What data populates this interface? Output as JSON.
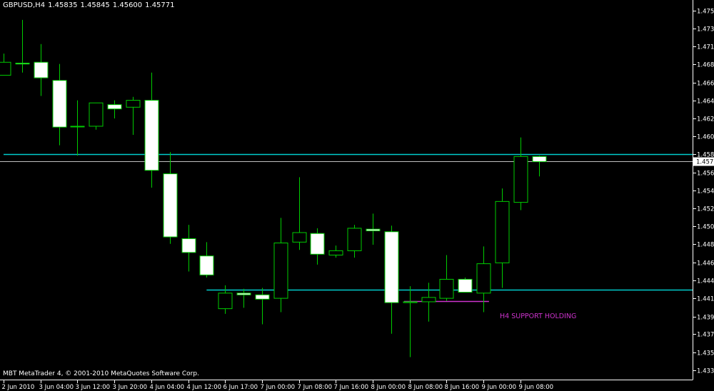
{
  "header": {
    "symbol_tf": "GBPUSD,H4",
    "open": "1.45835",
    "high": "1.45845",
    "low": "1.45600",
    "close": "1.45771"
  },
  "copyright": "MBT MetaTrader 4, © 2001-2010 MetaQuotes Software Corp.",
  "annotation": "H4 SUPPORT HOLDING",
  "colors": {
    "background": "#000000",
    "bull_body": "#000000",
    "bear_body": "#ffffff",
    "candle_outline": "#00cc00",
    "resistance_line": "#00cccc",
    "support_line": "#00cccc",
    "bid_line": "#bfbfbf",
    "annotation": "#cc33cc",
    "axis": "#ffffff"
  },
  "chart_data": {
    "type": "candlestick",
    "symbol": "GBPUSD",
    "timeframe": "H4",
    "ylim": [
      1.4325,
      1.4764
    ],
    "y_ticks": [
      "1.47520",
      "1.47310",
      "1.47105",
      "1.46895",
      "1.46685",
      "1.46480",
      "1.46270",
      "1.46065",
      "1.45855",
      "1.45645",
      "1.45440",
      "1.45230",
      "1.45025",
      "1.44815",
      "1.44605",
      "1.44400",
      "1.44190",
      "1.43980",
      "1.43775",
      "1.43565",
      "1.43360"
    ],
    "x_labels": [
      {
        "bar": 0,
        "label": "2 Jun 2010"
      },
      {
        "bar": 2,
        "label": "3 Jun 04:00"
      },
      {
        "bar": 4,
        "label": "3 Jun 12:00"
      },
      {
        "bar": 6,
        "label": "3 Jun 20:00"
      },
      {
        "bar": 8,
        "label": "4 Jun 04:00"
      },
      {
        "bar": 10,
        "label": "4 Jun 12:00"
      },
      {
        "bar": 12,
        "label": "6 Jun 17:00"
      },
      {
        "bar": 14,
        "label": "7 Jun 00:00"
      },
      {
        "bar": 16,
        "label": "7 Jun 08:00"
      },
      {
        "bar": 18,
        "label": "7 Jun 16:00"
      },
      {
        "bar": 20,
        "label": "8 Jun 00:00"
      },
      {
        "bar": 22,
        "label": "8 Jun 08:00"
      },
      {
        "bar": 24,
        "label": "8 Jun 16:00"
      },
      {
        "bar": 26,
        "label": "9 Jun 00:00"
      },
      {
        "bar": 28,
        "label": "9 Jun 08:00"
      }
    ],
    "candles": [
      {
        "o": 1.4677,
        "h": 1.4702,
        "l": 1.468,
        "c": 1.4692
      },
      {
        "o": 1.4691,
        "h": 1.4741,
        "l": 1.468,
        "c": 1.469
      },
      {
        "o": 1.4692,
        "h": 1.4713,
        "l": 1.4653,
        "c": 1.4674
      },
      {
        "o": 1.4671,
        "h": 1.469,
        "l": 1.4596,
        "c": 1.4617
      },
      {
        "o": 1.4618,
        "h": 1.4648,
        "l": 1.4584,
        "c": 1.4618
      },
      {
        "o": 1.4618,
        "h": 1.4645,
        "l": 1.4614,
        "c": 1.4645
      },
      {
        "o": 1.4643,
        "h": 1.4648,
        "l": 1.4627,
        "c": 1.4638
      },
      {
        "o": 1.464,
        "h": 1.4652,
        "l": 1.4608,
        "c": 1.4648
      },
      {
        "o": 1.4648,
        "h": 1.468,
        "l": 1.4547,
        "c": 1.4567
      },
      {
        "o": 1.4563,
        "h": 1.4588,
        "l": 1.4482,
        "c": 1.449
      },
      {
        "o": 1.4488,
        "h": 1.4504,
        "l": 1.445,
        "c": 1.4472
      },
      {
        "o": 1.4468,
        "h": 1.4484,
        "l": 1.4443,
        "c": 1.4446
      },
      {
        "o": 1.4407,
        "h": 1.4434,
        "l": 1.4401,
        "c": 1.4425
      },
      {
        "o": 1.4425,
        "h": 1.443,
        "l": 1.4408,
        "c": 1.4423
      },
      {
        "o": 1.4423,
        "h": 1.4431,
        "l": 1.4389,
        "c": 1.4418
      },
      {
        "o": 1.4419,
        "h": 1.4512,
        "l": 1.4403,
        "c": 1.4483
      },
      {
        "o": 1.4484,
        "h": 1.4559,
        "l": 1.4475,
        "c": 1.4495
      },
      {
        "o": 1.4494,
        "h": 1.45,
        "l": 1.4458,
        "c": 1.447
      },
      {
        "o": 1.4469,
        "h": 1.448,
        "l": 1.4466,
        "c": 1.4474
      },
      {
        "o": 1.4474,
        "h": 1.4504,
        "l": 1.4466,
        "c": 1.45
      },
      {
        "o": 1.4499,
        "h": 1.4517,
        "l": 1.4481,
        "c": 1.4497
      },
      {
        "o": 1.4496,
        "h": 1.4503,
        "l": 1.4378,
        "c": 1.4414
      },
      {
        "o": 1.4414,
        "h": 1.4433,
        "l": 1.4351,
        "c": 1.4415
      },
      {
        "o": 1.4415,
        "h": 1.4437,
        "l": 1.4392,
        "c": 1.442
      },
      {
        "o": 1.4419,
        "h": 1.4469,
        "l": 1.4416,
        "c": 1.4441
      },
      {
        "o": 1.4441,
        "h": 1.4443,
        "l": 1.4427,
        "c": 1.4426
      },
      {
        "o": 1.4425,
        "h": 1.4479,
        "l": 1.4403,
        "c": 1.4459
      },
      {
        "o": 1.446,
        "h": 1.4546,
        "l": 1.4431,
        "c": 1.4531
      },
      {
        "o": 1.453,
        "h": 1.4605,
        "l": 1.4521,
        "c": 1.4583
      },
      {
        "o": 1.4583,
        "h": 1.4584,
        "l": 1.456,
        "c": 1.4577
      }
    ],
    "lines": [
      {
        "name": "resistance",
        "price": 1.4586,
        "from_bar": 0.0,
        "to_bar": "right-edge"
      },
      {
        "name": "support",
        "price": 1.4429,
        "from_bar": 11.0,
        "to_bar": "right-edge"
      },
      {
        "name": "bid",
        "price": 1.45771,
        "from_bar": "left-edge",
        "to_bar": "right-edge"
      },
      {
        "name": "support-marker",
        "price": 1.4416,
        "from_bar": 21.7,
        "to_bar": 26.3
      }
    ],
    "bid_price": "1.45771"
  }
}
